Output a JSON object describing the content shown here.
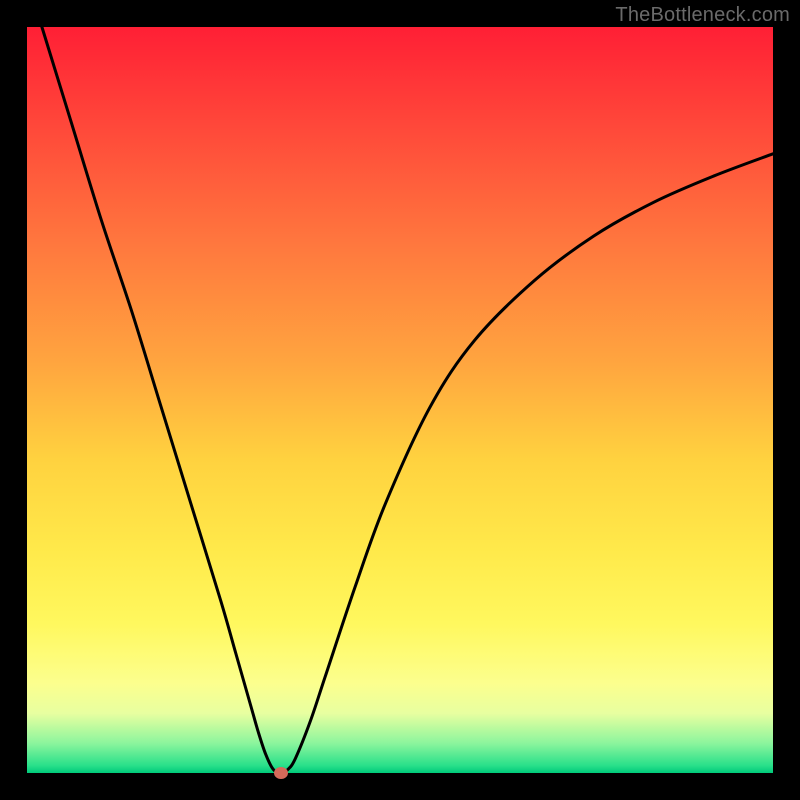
{
  "watermark": "TheBottleneck.com",
  "chart_data": {
    "type": "line",
    "title": "",
    "xlabel": "",
    "ylabel": "",
    "xlim": [
      0,
      100
    ],
    "ylim": [
      0,
      100
    ],
    "grid": false,
    "legend": false,
    "series": [
      {
        "name": "curve",
        "x": [
          2,
          6,
          10,
          14,
          18,
          22,
          26,
          28,
          30,
          31,
          32,
          33,
          34,
          35,
          36,
          38,
          40,
          44,
          48,
          54,
          60,
          68,
          76,
          84,
          92,
          100
        ],
        "y": [
          100,
          87,
          74,
          62,
          49,
          36,
          23,
          16,
          9,
          5.5,
          2.5,
          0.5,
          0,
          0.5,
          2,
          7,
          13,
          25,
          36,
          49,
          58,
          66,
          72,
          76.5,
          80,
          83
        ]
      }
    ],
    "minimum_marker": {
      "x": 34,
      "y": 0
    },
    "gradient_stops": [
      {
        "pos": 0,
        "color": "#ff1f35"
      },
      {
        "pos": 14,
        "color": "#ff4a3a"
      },
      {
        "pos": 30,
        "color": "#ff7a3e"
      },
      {
        "pos": 45,
        "color": "#ffa53f"
      },
      {
        "pos": 58,
        "color": "#ffd23f"
      },
      {
        "pos": 70,
        "color": "#ffe94a"
      },
      {
        "pos": 80,
        "color": "#fff85e"
      },
      {
        "pos": 88,
        "color": "#fcff8e"
      },
      {
        "pos": 92,
        "color": "#e8ffa0"
      },
      {
        "pos": 96,
        "color": "#8cf59d"
      },
      {
        "pos": 99,
        "color": "#29e08a"
      },
      {
        "pos": 100,
        "color": "#00c97a"
      }
    ]
  }
}
